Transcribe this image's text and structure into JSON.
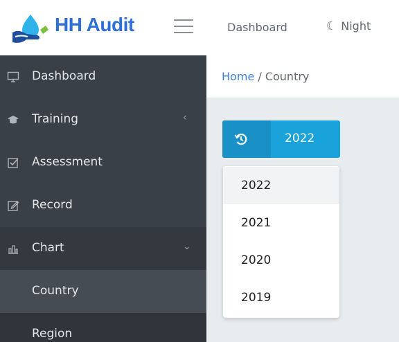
{
  "brand": {
    "name": "HH Audit"
  },
  "topnav": {
    "dashboard": "Dashboard",
    "night": "Night"
  },
  "sidebar": {
    "items": [
      {
        "label": "Dashboard",
        "icon": "monitor-icon"
      },
      {
        "label": "Training",
        "icon": "graduation-cap-icon",
        "caret": "‹"
      },
      {
        "label": "Assessment",
        "icon": "check-square-icon"
      },
      {
        "label": "Record",
        "icon": "edit-icon"
      },
      {
        "label": "Chart",
        "icon": "bar-chart-icon",
        "caret": "⌄"
      }
    ],
    "subitems": [
      {
        "label": "Country",
        "active": true
      },
      {
        "label": "Region",
        "active": false
      }
    ]
  },
  "breadcrumb": {
    "home": "Home",
    "separator": "/",
    "current": "Country"
  },
  "year_select": {
    "value": "2022",
    "icon": "history-icon"
  },
  "dropdown": {
    "options": [
      "2022",
      "2021",
      "2020",
      "2019"
    ],
    "selected": "2022"
  },
  "colors": {
    "accent": "#1aa3db",
    "sidebar": "#3a4047",
    "brand": "#2f6fd8"
  }
}
